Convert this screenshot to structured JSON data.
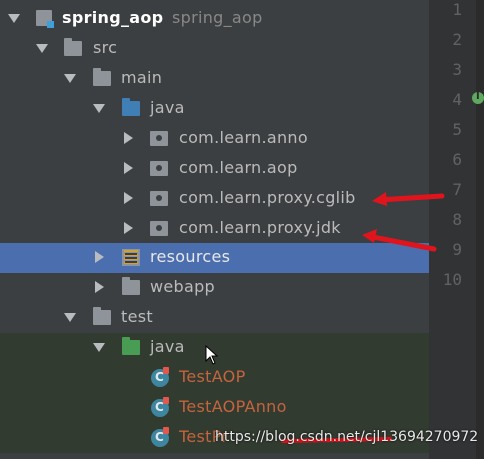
{
  "tree": {
    "project": {
      "name": "spring_aop",
      "path": "spring_aop"
    },
    "src": "src",
    "main": "main",
    "main_java": "java",
    "packages": [
      "com.learn.anno",
      "com.learn.aop",
      "com.learn.proxy.cglib",
      "com.learn.proxy.jdk"
    ],
    "resources": "resources",
    "webapp": "webapp",
    "test": "test",
    "test_java": "java",
    "test_classes": [
      "TestAOP",
      "TestAOPAnno",
      "TestPr"
    ]
  },
  "gutter": {
    "line_numbers": [
      "1",
      "2",
      "3",
      "4",
      "5",
      "6",
      "7",
      "8",
      "9",
      "10"
    ]
  },
  "watermark": "https://blog.csdn.net/cjl13694270972",
  "colors": {
    "selection": "#4b6eaf",
    "annotation_arrow": "#e0141c",
    "error_text": "#c5643e"
  }
}
